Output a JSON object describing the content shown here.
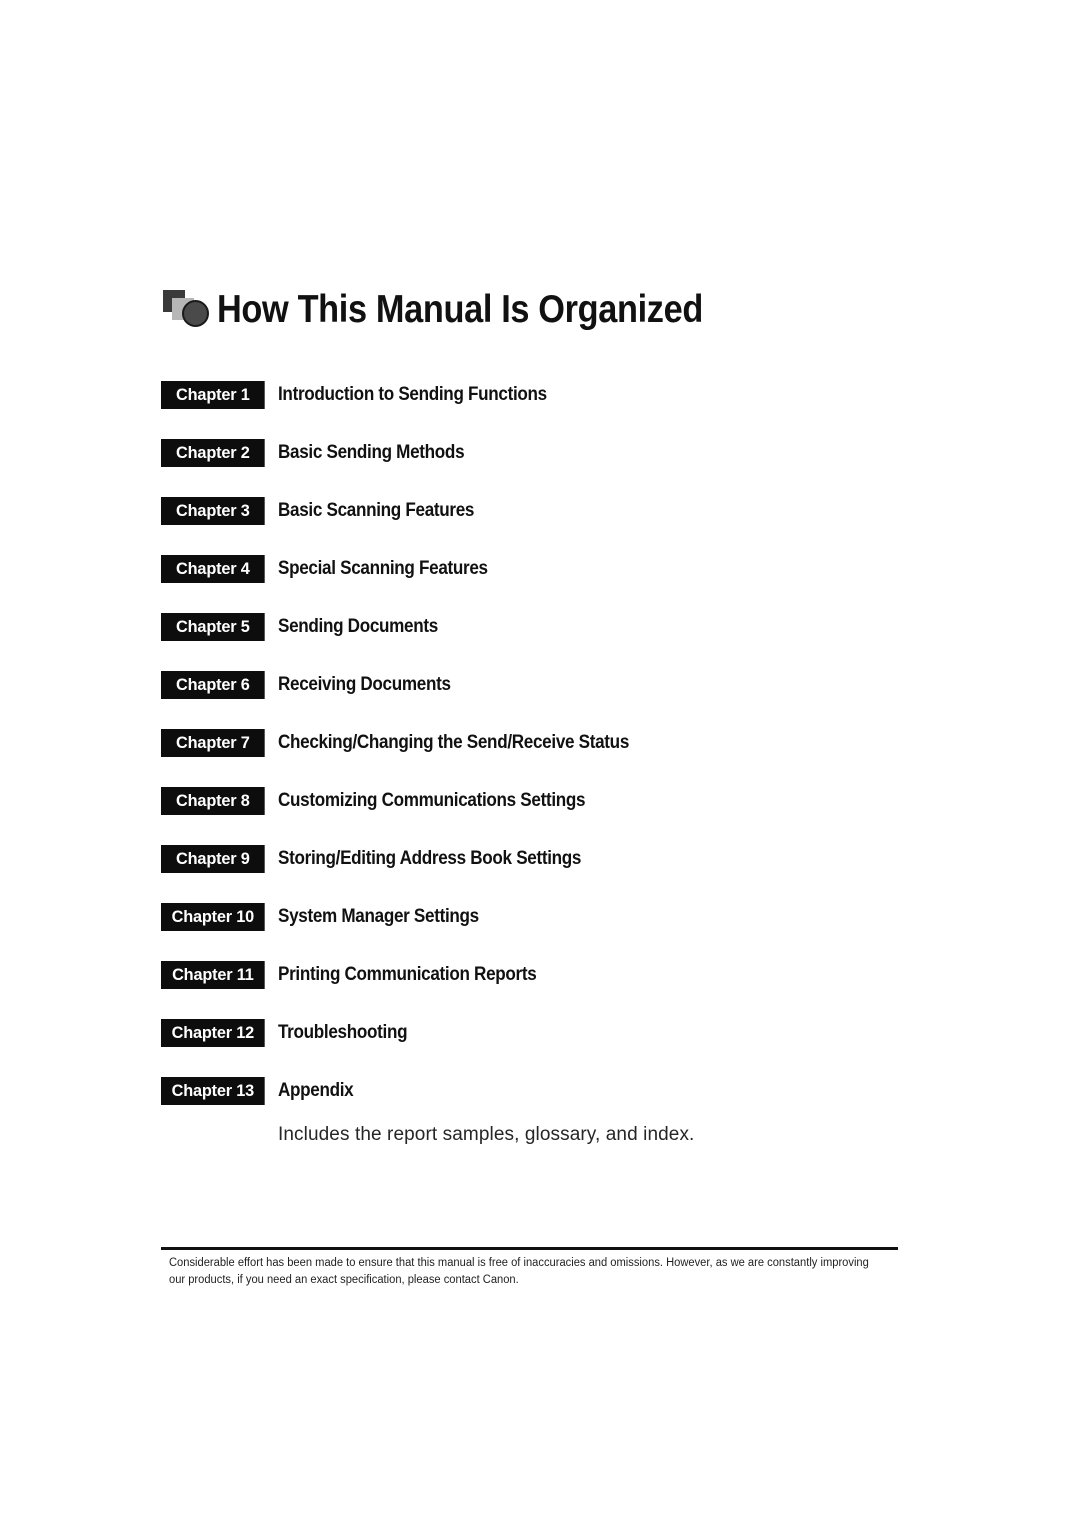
{
  "page": {
    "background_color": "#ffffff",
    "text_color": "#111111"
  },
  "header": {
    "icon": "layered-squares-circle-icon",
    "title": "How This Manual Is Organized"
  },
  "chapters": [
    {
      "badge": "Chapter 1",
      "title": "Introduction to Sending Functions"
    },
    {
      "badge": "Chapter 2",
      "title": "Basic Sending Methods"
    },
    {
      "badge": "Chapter 3",
      "title": "Basic Scanning Features"
    },
    {
      "badge": "Chapter 4",
      "title": "Special Scanning Features"
    },
    {
      "badge": "Chapter 5",
      "title": "Sending Documents"
    },
    {
      "badge": "Chapter 6",
      "title": "Receiving Documents"
    },
    {
      "badge": "Chapter 7",
      "title": "Checking/Changing the Send/Receive Status"
    },
    {
      "badge": "Chapter 8",
      "title": "Customizing Communications Settings"
    },
    {
      "badge": "Chapter 9",
      "title": "Storing/Editing Address Book Settings"
    },
    {
      "badge": "Chapter 10",
      "title": "System Manager Settings"
    },
    {
      "badge": "Chapter 11",
      "title": "Printing Communication Reports"
    },
    {
      "badge": "Chapter 12",
      "title": "Troubleshooting"
    },
    {
      "badge": "Chapter 13",
      "title": "Appendix"
    }
  ],
  "appendix_note": "Includes the report samples, glossary, and index.",
  "footer": {
    "note": "Considerable effort has been made to ensure that this manual is free of inaccuracies and omissions. However, as we are constantly improving our products, if you need an exact specification, please contact Canon."
  }
}
